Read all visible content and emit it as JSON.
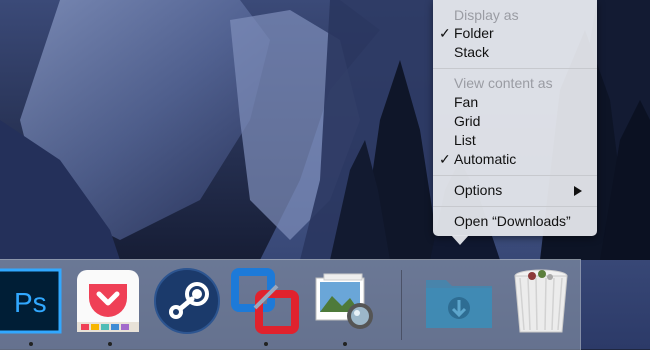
{
  "menu": {
    "sections": [
      {
        "header": "Display as",
        "items": [
          {
            "label": "Folder",
            "checked": true
          },
          {
            "label": "Stack",
            "checked": false
          }
        ]
      },
      {
        "header": "View content as",
        "items": [
          {
            "label": "Fan",
            "checked": false
          },
          {
            "label": "Grid",
            "checked": false
          },
          {
            "label": "List",
            "checked": false
          },
          {
            "label": "Automatic",
            "checked": true
          }
        ]
      }
    ],
    "options_label": "Options",
    "open_label": "Open “Downloads”",
    "check_glyph": "✓"
  },
  "dock": {
    "apps": [
      {
        "name": "Photoshop",
        "icon_text": "Ps",
        "icon": "photoshop-icon",
        "running": true
      },
      {
        "name": "Pocket",
        "icon": "pocket-icon",
        "running": true
      },
      {
        "name": "Steam",
        "icon": "steam-icon",
        "running": false
      },
      {
        "name": "VMware Fusion",
        "icon": "vmware-icon",
        "running": true
      },
      {
        "name": "Preview",
        "icon": "preview-icon",
        "running": true
      },
      {
        "name": "Downloads",
        "icon": "downloads-folder-icon",
        "running": false
      },
      {
        "name": "Trash",
        "icon": "trash-icon",
        "running": false
      }
    ]
  },
  "colors": {
    "photoshop_blue": "#31a8ff",
    "photoshop_bg": "#001e36",
    "pocket_red": "#ef4056",
    "steam_blue": "#1b3a6b",
    "vmware_blue": "#1d7ad8",
    "vmware_red": "#e0222d",
    "folder_blue": "#3f8bb5"
  }
}
